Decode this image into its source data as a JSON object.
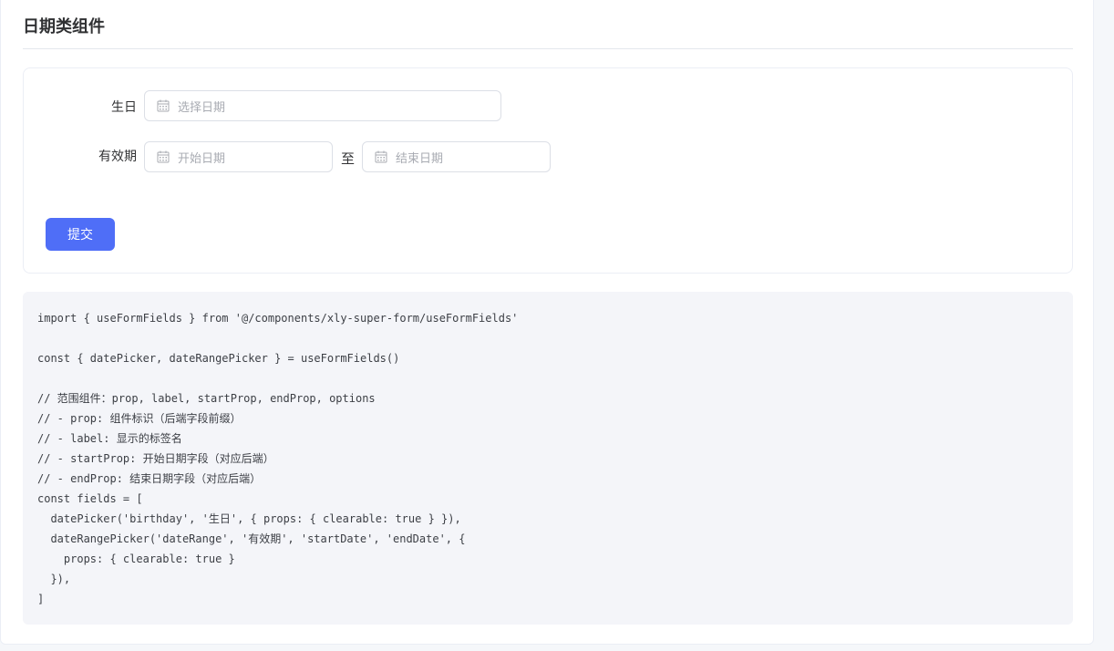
{
  "section": {
    "title": "日期类组件"
  },
  "form": {
    "birthday": {
      "label": "生日",
      "placeholder": "选择日期",
      "icon": "calendar-icon"
    },
    "validity": {
      "label": "有效期",
      "start_placeholder": "开始日期",
      "separator": "至",
      "end_placeholder": "结束日期",
      "icon": "calendar-icon"
    },
    "submit_label": "提交"
  },
  "colors": {
    "primary": "#4f6ef7",
    "code_background": "#f4f5f9",
    "border": "#dcdfe6",
    "placeholder": "#a8abb2"
  },
  "code": {
    "lines": [
      "import { useFormFields } from '@/components/xly-super-form/useFormFields'",
      "",
      "const { datePicker, dateRangePicker } = useFormFields()",
      "",
      "// 范围组件：prop, label, startProp, endProp, options",
      "// - prop: 组件标识（后端字段前缀）",
      "// - label: 显示的标签名",
      "// - startProp: 开始日期字段（对应后端）",
      "// - endProp: 结束日期字段（对应后端）",
      "const fields = [",
      "  datePicker('birthday', '生日', { props: { clearable: true } }),",
      "  dateRangePicker('dateRange', '有效期', 'startDate', 'endDate', {",
      "    props: { clearable: true }",
      "  }),",
      "]"
    ]
  }
}
